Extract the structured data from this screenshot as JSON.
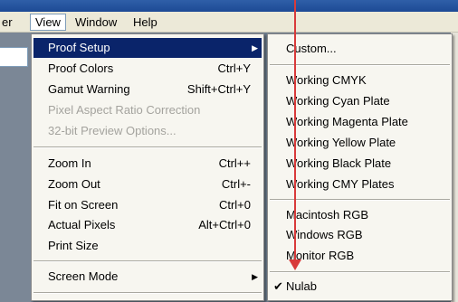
{
  "menubar": {
    "partial_item": "er",
    "items": [
      "View",
      "Window",
      "Help"
    ]
  },
  "view_menu": {
    "items": [
      {
        "label": "Proof Setup",
        "shortcut": "",
        "submenu": true,
        "highlighted": true
      },
      {
        "label": "Proof Colors",
        "shortcut": "Ctrl+Y"
      },
      {
        "label": "Gamut Warning",
        "shortcut": "Shift+Ctrl+Y"
      },
      {
        "label": "Pixel Aspect Ratio Correction",
        "shortcut": "",
        "disabled": true
      },
      {
        "label": "32-bit Preview Options...",
        "shortcut": "",
        "disabled": true
      },
      {
        "label": "Zoom In",
        "shortcut": "Ctrl++"
      },
      {
        "label": "Zoom Out",
        "shortcut": "Ctrl+-"
      },
      {
        "label": "Fit on Screen",
        "shortcut": "Ctrl+0"
      },
      {
        "label": "Actual Pixels",
        "shortcut": "Alt+Ctrl+0"
      },
      {
        "label": "Print Size",
        "shortcut": ""
      },
      {
        "label": "Screen Mode",
        "shortcut": "",
        "submenu": true
      }
    ]
  },
  "proof_submenu": {
    "items": [
      {
        "label": "Custom..."
      },
      {
        "label": "Working CMYK"
      },
      {
        "label": "Working Cyan Plate"
      },
      {
        "label": "Working Magenta Plate"
      },
      {
        "label": "Working Yellow Plate"
      },
      {
        "label": "Working Black Plate"
      },
      {
        "label": "Working CMY Plates"
      },
      {
        "label": "Macintosh RGB"
      },
      {
        "label": "Windows RGB"
      },
      {
        "label": "Monitor RGB"
      },
      {
        "label": "Nulab",
        "checked": true
      }
    ]
  },
  "colors": {
    "highlight": "#0a246a",
    "menu_bg": "#f7f6f0",
    "annotation_arrow": "#d83a3a"
  },
  "icons": [
    "submenu-arrow-icon",
    "checkmark-icon",
    "annotation-arrow-icon"
  ]
}
